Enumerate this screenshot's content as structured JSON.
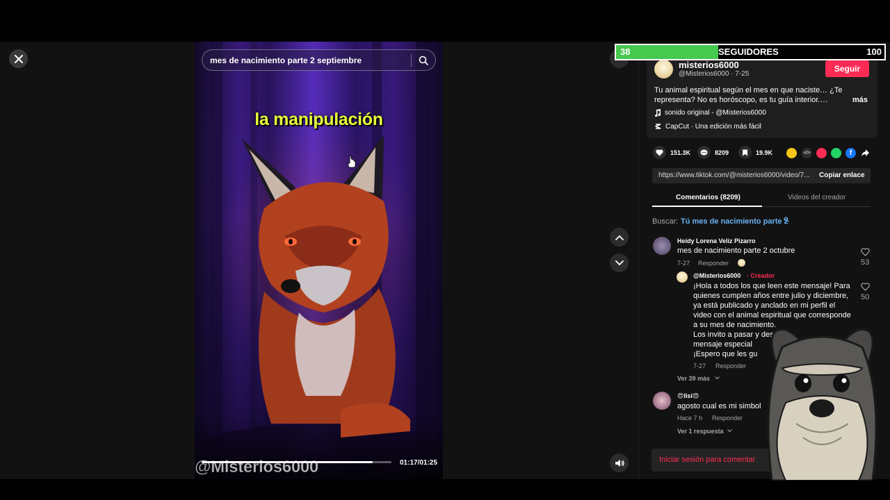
{
  "search": {
    "query": "mes de nacimiento parte 2 septiembre"
  },
  "video": {
    "caption": "la manipulación",
    "watermark": "@Misterios6000",
    "time": "01:17/01:25",
    "progress": 0.9
  },
  "follow_goal": {
    "current": "38",
    "label": "SEGUIDORES",
    "target": "100",
    "progress": 0.38
  },
  "creator": {
    "name": "misterios6000",
    "handle_date": "@Misterios6000 · 7-25",
    "follow_label": "Seguir",
    "description_line1": "Tu animal espiritual según el mes en que naciste… ¿Te",
    "description_line2": "representa? No es horóscopo, es tu guía interior.…",
    "more": "más",
    "sound": "sonido original - @Misterios6000",
    "capcut": "CapCut · Una edición más fácil"
  },
  "actions": {
    "likes": "151.3K",
    "comments": "8209",
    "saves": "19.9K"
  },
  "link": {
    "url": "https://www.tiktok.com/@misterios6000/video/7...",
    "copy_label": "Copiar enlace"
  },
  "tabs": {
    "comments": "Comentarios (8209)",
    "creator_videos": "Videos del creador"
  },
  "suggest": {
    "prefix": "Buscar:",
    "query": "Tú mes de nacimiento parte 2"
  },
  "comments": [
    {
      "user": "Heidy Lorena Veliz Pizarro",
      "text": "mes de nacimiento parte 2 octubre",
      "date": "7-27",
      "reply": "Responder",
      "likes": "53"
    },
    {
      "user": "@Misterios6000",
      "badge": "· Creador",
      "lines": [
        "¡Hola a todos los que leen este mensaje! Para",
        "quienes cumplen años entre julio y diciembre,",
        "ya está publicado y anclado en mi perfil el",
        "video con el animal espiritual que corresponde",
        "a su mes de nacimiento.",
        "Los invito a pasar y descubrir",
        "mensaje especial",
        "¡Espero que les gu"
      ],
      "date": "7-27",
      "reply": "Responder",
      "likes": "50"
    },
    {
      "more": "Ver 39 más"
    },
    {
      "user": "😍lisi😍",
      "text": "agosto cual es mi simbol",
      "date": "Hace 7 h",
      "reply": "Responder",
      "more": "Ver 1 respuesta"
    }
  ],
  "login_prompt": "Iniciar sesión para comentar",
  "colors": {
    "accent": "#fe2c55",
    "caption": "#e7ff3b",
    "goal_green": "#47c84f",
    "link_blue": "#6ab3f3"
  }
}
